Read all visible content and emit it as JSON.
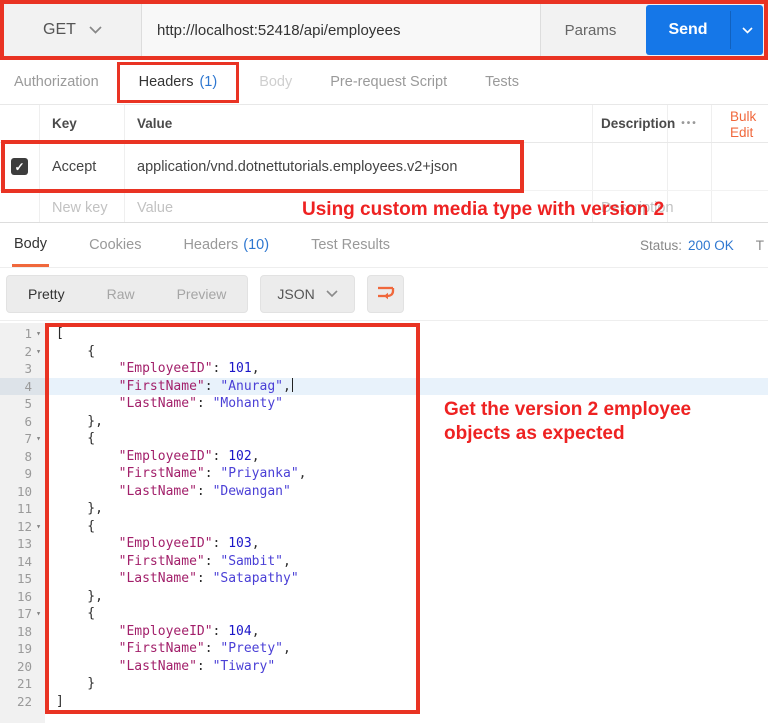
{
  "colors": {
    "highlight_box_red": "#e93323",
    "annotation_red": "#ee2222",
    "postman_orange": "#f0683c",
    "link_blue": "#2e77d0",
    "send_button_blue": "#1577e8",
    "json_key": "#a21f6a",
    "json_string": "#4a3fd6",
    "json_number": "#1b16c8",
    "line_highlight": "#e8f2fb"
  },
  "request_bar": {
    "method": "GET",
    "url": "http://localhost:52418/api/employees",
    "params_label": "Params",
    "send_label": "Send"
  },
  "request_tabs": {
    "authorization": "Authorization",
    "headers": "Headers",
    "headers_count": "(1)",
    "body": "Body",
    "prerequest": "Pre-request Script",
    "tests": "Tests"
  },
  "headers_table": {
    "col_key": "Key",
    "col_value": "Value",
    "col_description": "Description",
    "more_dots": "•••",
    "bulk_edit": "Bulk Edit",
    "row": {
      "key": "Accept",
      "value": "application/vnd.dotnettutorials.employees.v2+json",
      "checked": "✓"
    },
    "new_row": {
      "key_placeholder": "New key",
      "value_placeholder": "Value",
      "description_placeholder": "Description"
    }
  },
  "annotations": {
    "headers_note": "Using custom media type with version 2",
    "response_note": "Get the version 2 employee objects as expected"
  },
  "response_tabs": {
    "body": "Body",
    "cookies": "Cookies",
    "headers": "Headers",
    "headers_count": "(10)",
    "test_results": "Test Results",
    "status_label": "Status:",
    "status_value": "200 OK",
    "time_partial": "T"
  },
  "response_toolbar": {
    "pretty": "Pretty",
    "raw": "Raw",
    "preview": "Preview",
    "format": "JSON"
  },
  "response_body": {
    "highlighted_line": 4,
    "employees": [
      {
        "EmployeeID": 101,
        "FirstName": "Anurag",
        "LastName": "Mohanty"
      },
      {
        "EmployeeID": 102,
        "FirstName": "Priyanka",
        "LastName": "Dewangan"
      },
      {
        "EmployeeID": 103,
        "FirstName": "Sambit",
        "LastName": "Satapathy"
      },
      {
        "EmployeeID": 104,
        "FirstName": "Preety",
        "LastName": "Tiwary"
      }
    ]
  }
}
